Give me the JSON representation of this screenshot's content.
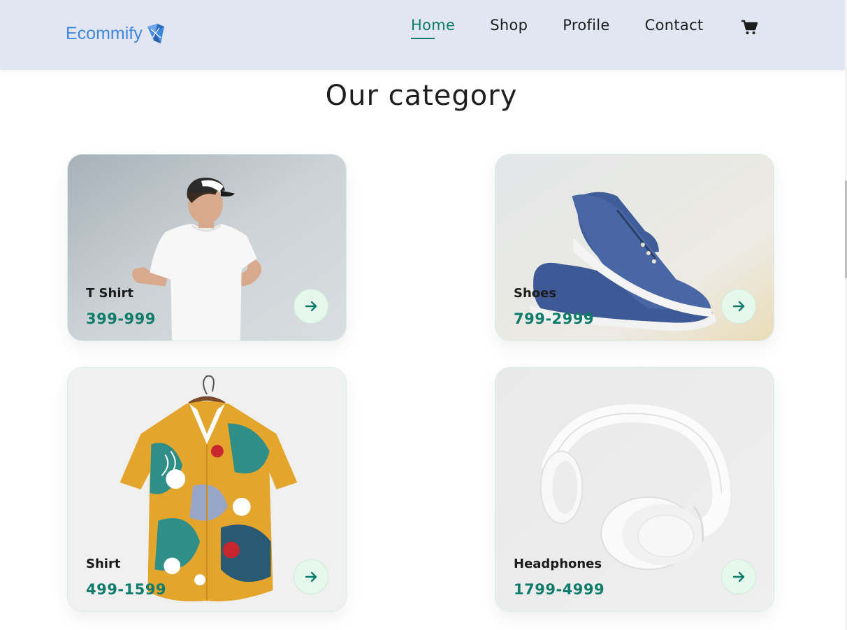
{
  "header": {
    "logo_text": "Ecommify",
    "nav": [
      {
        "label": "Home",
        "active": true
      },
      {
        "label": "Shop",
        "active": false
      },
      {
        "label": "Profile",
        "active": false
      },
      {
        "label": "Contact",
        "active": false
      }
    ],
    "cart_icon": "cart-icon"
  },
  "section": {
    "title": "Our category"
  },
  "categories": [
    {
      "name": "T Shirt",
      "price": "399-999",
      "image": "tshirt-model-image"
    },
    {
      "name": "Shoes",
      "price": "799-2999",
      "image": "shoes-image"
    },
    {
      "name": "Shirt",
      "price": "499-1599",
      "image": "shirt-image"
    },
    {
      "name": "Headphones",
      "price": "1799-4999",
      "image": "headphones-image"
    }
  ],
  "colors": {
    "accent": "#0e7c6b",
    "header_bg": "#e2e6f3",
    "logo": "#3f88e0",
    "arrow_bg": "#e6f7ec"
  }
}
